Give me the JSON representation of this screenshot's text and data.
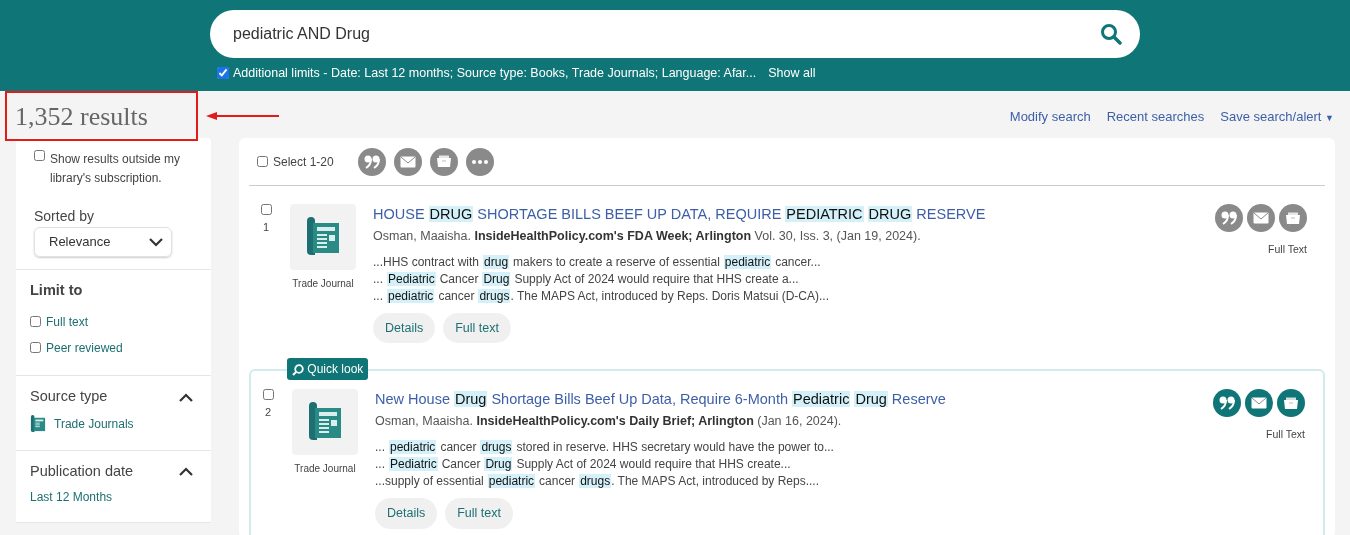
{
  "search": {
    "query": "pediatric AND Drug",
    "limits_checked": true,
    "limits": "Additional limits - Date: Last 12 months; Source type: Books, Trade Journals; Language: Afar...",
    "show_all": "Show all"
  },
  "results_header": {
    "count": "1,352 results",
    "annotated": true
  },
  "top_links": [
    {
      "label": "Modify search"
    },
    {
      "label": "Recent searches"
    },
    {
      "label": "Save search/alert",
      "caret": "▼"
    }
  ],
  "sidebar": {
    "outside": {
      "label": "Show results outside my library's subscription.",
      "checked": false
    },
    "sort": {
      "label": "Sorted by",
      "value": "Relevance"
    },
    "limit": {
      "title": "Limit to",
      "options": [
        {
          "label": "Full text",
          "checked": false
        },
        {
          "label": "Peer reviewed",
          "checked": false
        }
      ]
    },
    "source_type": {
      "title": "Source type",
      "expanded": true,
      "items": [
        "Trade Journals"
      ]
    },
    "publication_date": {
      "title": "Publication date",
      "expanded": true,
      "items": [
        "Last 12 Months"
      ]
    }
  },
  "toolbar": {
    "select_label": "Select 1-20",
    "select_checked": false
  },
  "results": [
    {
      "number": "1",
      "checked": false,
      "focused": false,
      "type": "Trade Journal",
      "title": [
        {
          "t": "HOUSE",
          "hit": false
        },
        {
          "t": "DRUG",
          "hit": true
        },
        {
          "t": "SHORTAGE BILLS BEEF UP DATA, REQUIRE",
          "hit": false
        },
        {
          "t": "PEDIATRIC",
          "hit": true
        },
        {
          "t": "DRUG",
          "hit": true
        },
        {
          "t": "RESERVE",
          "hit": false
        }
      ],
      "author": "Osman, Maaisha.",
      "source": "InsideHealthPolicy.com's FDA Week; Arlington",
      "details": "Vol. 30, Iss. 3,  (Jan 19, 2024).",
      "snippets": [
        [
          {
            "t": "...HHS contract with",
            "hit": false
          },
          {
            "t": "drug",
            "hit": true
          },
          {
            "t": "makers to create a reserve of essential",
            "hit": false
          },
          {
            "t": "pediatric",
            "hit": true
          },
          {
            "t": "cancer...",
            "hit": false
          }
        ],
        [
          {
            "t": "...",
            "hit": false
          },
          {
            "t": "Pediatric",
            "hit": true
          },
          {
            "t": "Cancer",
            "hit": false
          },
          {
            "t": "Drug",
            "hit": true
          },
          {
            "t": "Supply Act of 2024 would require that HHS create a...",
            "hit": false
          }
        ],
        [
          {
            "t": "...",
            "hit": false
          },
          {
            "t": "pediatric",
            "hit": true
          },
          {
            "t": "cancer",
            "hit": false
          },
          {
            "t": "drugs",
            "hit": true
          },
          {
            "t": ". The MAPS Act, introduced by Reps. Doris Matsui (D-CA)...",
            "hit": false
          }
        ]
      ],
      "buttons": [
        "Details",
        "Full text"
      ],
      "availability": "Full Text"
    },
    {
      "number": "2",
      "checked": false,
      "focused": true,
      "badge": "Quick look",
      "type": "Trade Journal",
      "title": [
        {
          "t": "New House",
          "hit": false
        },
        {
          "t": "Drug",
          "hit": true
        },
        {
          "t": "Shortage Bills Beef Up Data, Require 6-Month",
          "hit": false
        },
        {
          "t": "Pediatric",
          "hit": true
        },
        {
          "t": "Drug",
          "hit": true
        },
        {
          "t": "Reserve",
          "hit": false
        }
      ],
      "author": "Osman, Maaisha.",
      "source": "InsideHealthPolicy.com's Daily Brief; Arlington",
      "details": "(Jan 16, 2024).",
      "snippets": [
        [
          {
            "t": "...",
            "hit": false
          },
          {
            "t": "pediatric",
            "hit": true
          },
          {
            "t": "cancer",
            "hit": false
          },
          {
            "t": "drugs",
            "hit": true
          },
          {
            "t": "stored in reserve. HHS secretary would have the power to...",
            "hit": false
          }
        ],
        [
          {
            "t": "...",
            "hit": false
          },
          {
            "t": "Pediatric",
            "hit": true
          },
          {
            "t": "Cancer",
            "hit": false
          },
          {
            "t": "Drug",
            "hit": true
          },
          {
            "t": "Supply Act of 2024 would require that HHS create...",
            "hit": false
          }
        ],
        [
          {
            "t": "...supply of essential",
            "hit": false
          },
          {
            "t": "pediatric",
            "hit": true
          },
          {
            "t": "cancer",
            "hit": false
          },
          {
            "t": "drugs",
            "hit": true
          },
          {
            "t": ". The MAPS Act, introduced by Reps....",
            "hit": false
          }
        ]
      ],
      "buttons": [
        "Details",
        "Full text"
      ],
      "availability": "Full Text"
    }
  ]
}
